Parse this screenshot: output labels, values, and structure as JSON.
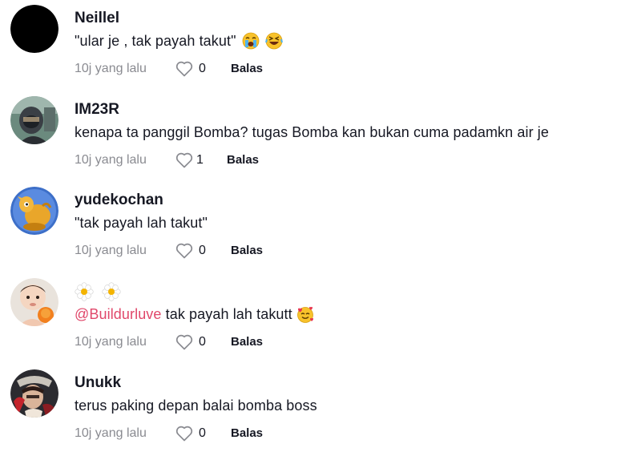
{
  "comments": [
    {
      "username": "Neillel",
      "text": "\"ular je , tak payah takut\"",
      "emojis": [
        "crying-face-emoji",
        "rolling-laughing-emoji"
      ],
      "time": "10j yang lalu",
      "likes": "0",
      "reply_label": "Balas",
      "avatar": "black-circle-avatar"
    },
    {
      "username": "IM23R",
      "text": "kenapa ta panggil Bomba? tugas Bomba kan bukan cuma padamkn air je",
      "time": "10j yang lalu",
      "likes": "1",
      "reply_label": "Balas",
      "avatar": "helmet-rider-avatar"
    },
    {
      "username": "yudekochan",
      "text": "\"tak payah lah takut\"",
      "time": "10j yang lalu",
      "likes": "0",
      "reply_label": "Balas",
      "avatar": "cartoon-camel-avatar"
    },
    {
      "username_icons": [
        "flower-icon",
        "flower-icon"
      ],
      "mention": "@Buildurluve",
      "text": " tak payah lah takutt",
      "emojis": [
        "smiling-hearts-emoji"
      ],
      "time": "10j yang lalu",
      "likes": "0",
      "reply_label": "Balas",
      "avatar": "baby-photo-avatar"
    },
    {
      "username": "Unukk",
      "text": "terus paking depan balai bomba boss",
      "time": "10j yang lalu",
      "likes": "0",
      "reply_label": "Balas",
      "avatar": "anime-character-avatar"
    }
  ],
  "colors": {
    "text": "#161823",
    "muted": "#8a8b91",
    "mention": "#e0476a"
  }
}
